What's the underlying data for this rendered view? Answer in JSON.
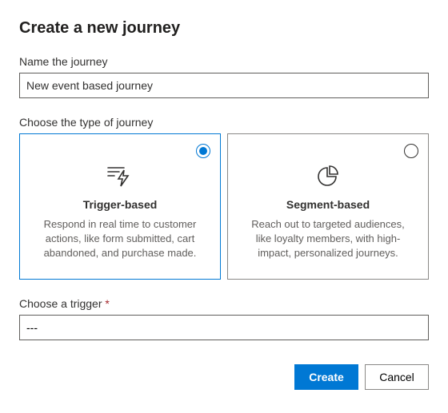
{
  "title": "Create a new journey",
  "name_field": {
    "label": "Name the journey",
    "value": "New event based journey"
  },
  "type_field": {
    "label": "Choose the type of journey",
    "options": [
      {
        "title": "Trigger-based",
        "desc": "Respond in real time to customer actions, like form submitted, cart abandoned, and purchase made.",
        "selected": true
      },
      {
        "title": "Segment-based",
        "desc": "Reach out to targeted audiences, like loyalty members, with high-impact, personalized journeys.",
        "selected": false
      }
    ]
  },
  "trigger_field": {
    "label": "Choose a trigger",
    "required_mark": "*",
    "value": "---"
  },
  "actions": {
    "create": "Create",
    "cancel": "Cancel"
  }
}
